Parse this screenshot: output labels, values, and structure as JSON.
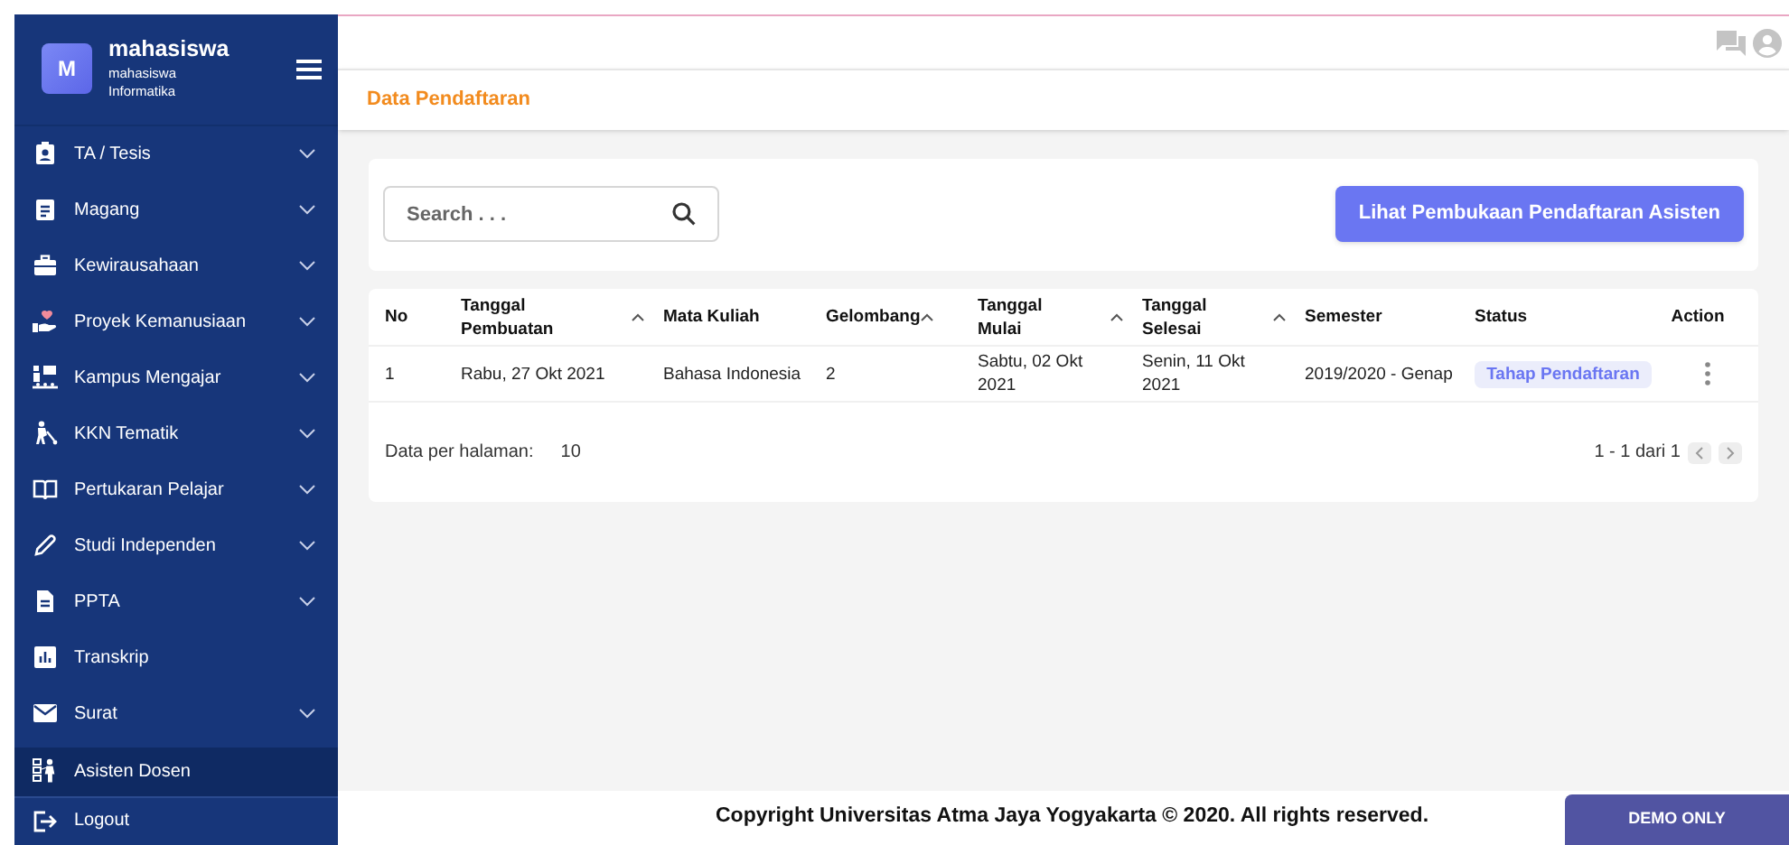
{
  "sidebar": {
    "avatar": "M",
    "user_name": "mahasiswa",
    "role": "mahasiswa",
    "department": "Informatika",
    "items": [
      {
        "label": "TA / Tesis",
        "expandable": true,
        "selected": false
      },
      {
        "label": "Magang",
        "expandable": true,
        "selected": false
      },
      {
        "label": "Kewirausahaan",
        "expandable": true,
        "selected": false
      },
      {
        "label": "Proyek Kemanusiaan",
        "expandable": true,
        "selected": false
      },
      {
        "label": "Kampus Mengajar",
        "expandable": true,
        "selected": false
      },
      {
        "label": "KKN Tematik",
        "expandable": true,
        "selected": false
      },
      {
        "label": "Pertukaran Pelajar",
        "expandable": true,
        "selected": false
      },
      {
        "label": "Studi Independen",
        "expandable": true,
        "selected": false
      },
      {
        "label": "PPTA",
        "expandable": true,
        "selected": false
      },
      {
        "label": "Transkrip",
        "expandable": false,
        "selected": false
      },
      {
        "label": "Surat",
        "expandable": true,
        "selected": false
      },
      {
        "label": "Asisten Dosen",
        "expandable": false,
        "selected": true
      }
    ],
    "logout": "Logout"
  },
  "breadcrumb": "Data Pendaftaran",
  "search": {
    "placeholder": "Search . . ."
  },
  "primary_button": "Lihat Pembukaan Pendaftaran Asisten",
  "table": {
    "columns": [
      {
        "label": "No",
        "sortable": false
      },
      {
        "label": "Tanggal Pembuatan",
        "sortable": true
      },
      {
        "label": "Mata Kuliah",
        "sortable": false
      },
      {
        "label": "Gelombang",
        "sortable": true
      },
      {
        "label": "Tanggal Mulai",
        "sortable": true
      },
      {
        "label": "Tanggal Selesai",
        "sortable": true
      },
      {
        "label": "Semester",
        "sortable": false
      },
      {
        "label": "Status",
        "sortable": false
      },
      {
        "label": "Action",
        "sortable": false
      }
    ],
    "rows": [
      {
        "cells": [
          "1",
          "Rabu, 27 Okt 2021",
          "Bahasa Indonesia",
          "2",
          "Sabtu, 02 Okt 2021",
          "Senin, 11 Okt 2021",
          "2019/2020 - Genap"
        ],
        "status": "Tahap Pendaftaran"
      }
    ]
  },
  "pagination": {
    "label": "Data per halaman:",
    "per_page": "10",
    "range": "1 - 1 dari 1"
  },
  "footer": {
    "copyright": "Copyright Universitas Atma Jaya Yogyakarta © 2020. All rights reserved.",
    "badge": "DEMO ONLY"
  }
}
